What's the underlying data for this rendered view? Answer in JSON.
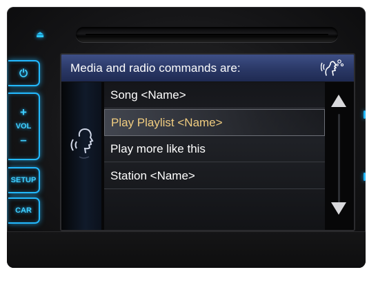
{
  "header": {
    "title": "Media and radio commands are:",
    "voice_icon": "voice-command-icon"
  },
  "commands": [
    {
      "label": "Song <Name>"
    },
    {
      "label": "Play Playlist <Name>",
      "selected": true
    },
    {
      "label": "Play more like this"
    },
    {
      "label": "Station <Name>"
    }
  ],
  "hardware_buttons": {
    "power_icon": "⏻",
    "vol_up": "+",
    "vol_label": "VOL",
    "vol_down": "–",
    "setup": "SETUP",
    "car": "CAR",
    "eject_icon": "⏏"
  },
  "colors": {
    "accent": "#23b9ff",
    "selected_text": "#f1cd80",
    "header": "#2a3866"
  }
}
